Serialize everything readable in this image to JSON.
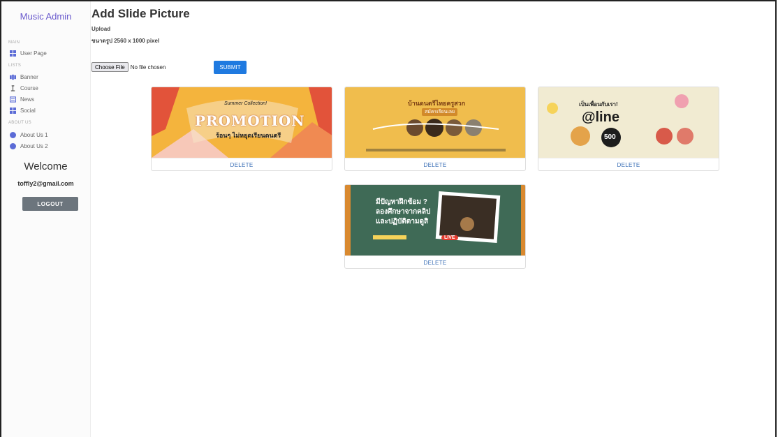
{
  "sidebar": {
    "brand": "Music Admin",
    "sections": [
      {
        "label": "MAIN",
        "items": [
          {
            "label": "User Page",
            "icon": "grid-icon"
          }
        ]
      },
      {
        "label": "LISTS",
        "items": [
          {
            "label": "Banner",
            "icon": "slides-icon"
          },
          {
            "label": "Course",
            "icon": "person-icon"
          },
          {
            "label": "News",
            "icon": "newspaper-icon"
          },
          {
            "label": "Social",
            "icon": "grid-icon"
          }
        ]
      },
      {
        "label": "ABOUT US",
        "items": [
          {
            "label": "About Us 1",
            "icon": "info-icon"
          },
          {
            "label": "About Us 2",
            "icon": "info-icon"
          }
        ]
      }
    ],
    "welcome": "Welcome",
    "email": "toffly2@gmail.com",
    "logout_label": "LOGOUT"
  },
  "main": {
    "title": "Add Slide Picture",
    "upload_label": "Upload",
    "size_hint": "ขนาดรูป 2560 x 1000 pixel",
    "file_input": {
      "button_label": "Choose File",
      "status": "No file chosen"
    },
    "submit_label": "SUBMIT",
    "slides": [
      {
        "delete_label": "DELETE",
        "texts": {
          "headline": "PROMOTION",
          "script": "Summer Collection!",
          "sub": "ร้อนๆ ไม่หยุดเรียนดนตรี"
        }
      },
      {
        "delete_label": "DELETE",
        "texts": {
          "headline": "บ้านดนตรีไทยครูสวก",
          "sub": "สมัครเรียนเลย"
        }
      },
      {
        "delete_label": "DELETE",
        "texts": {
          "headline": "เป็นเพื่อนกับเรา!",
          "brand": "@line",
          "badge": "500"
        }
      },
      {
        "delete_label": "DELETE",
        "texts": {
          "headline": "มีปัญหาฝึกซ้อม ?",
          "line2": "ลองศึกษาจากคลิป",
          "line3": "และปฏิบัติตามดูสิ",
          "live": "LIVE"
        }
      }
    ]
  },
  "colors": {
    "accent": "#1f7ae0",
    "brand": "#6a5acd",
    "logout": "#6c757d",
    "delete_text": "#3b6fb6"
  }
}
